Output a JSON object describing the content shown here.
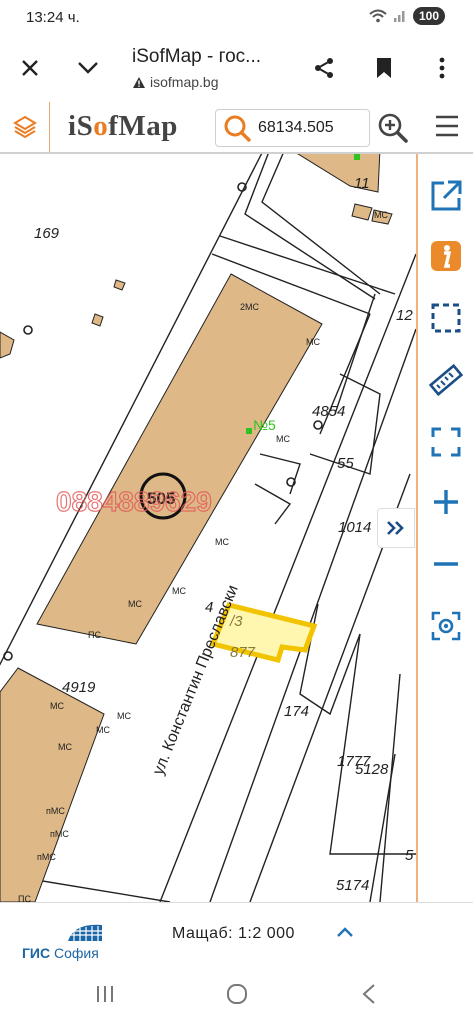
{
  "status": {
    "time": "13:24 ч.",
    "battery": "100"
  },
  "browser": {
    "title": "iSofMap - гос...",
    "url": "isofmap.bg"
  },
  "header": {
    "logo_prefix": "i",
    "logo_accent": "S",
    "logo_o": "o",
    "logo_suffix": "fMap",
    "search_value": "68134.505",
    "accent_color": "#ea7d22"
  },
  "map": {
    "parcel_labels": [
      "169",
      "505",
      "4919",
      "4854",
      "55",
      "1014",
      "12",
      "11",
      "877",
      "174",
      "1777",
      "5128",
      "5174",
      "5",
      "4"
    ],
    "building_labels": [
      "2МС",
      "МС",
      "МС",
      "МС",
      "МС",
      "ПС",
      "МС",
      "МС",
      "МС",
      "пМС",
      "пМС",
      "пМС",
      "ПС",
      "МС",
      "МС",
      "МС"
    ],
    "highlight_label": "/3",
    "number_label": "№5",
    "street_name": "ул. Константин Преславски",
    "watermark": "0884889629"
  },
  "tools": [
    "open-external-icon",
    "info-icon",
    "select-area-icon",
    "measure-ruler-icon",
    "fullscreen-icon",
    "zoom-in-icon",
    "zoom-out-icon",
    "locate-icon"
  ],
  "footer": {
    "gis_name": "ГИС",
    "gis_city": "София",
    "scale_label": "Мащаб: 1:2 000"
  }
}
